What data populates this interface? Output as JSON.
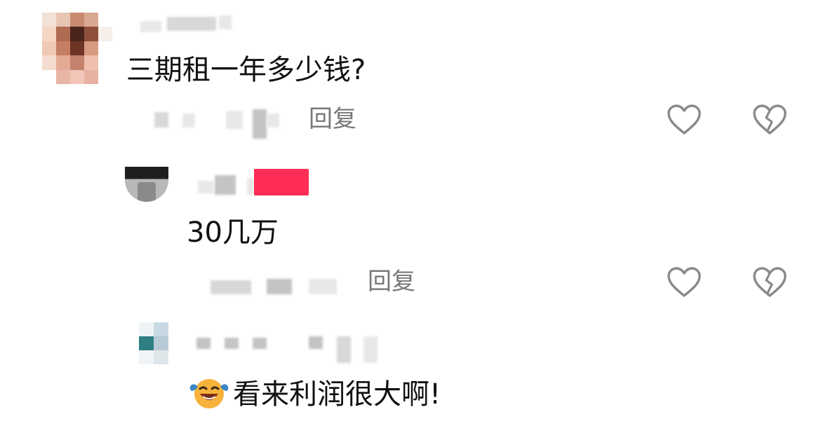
{
  "comments": [
    {
      "text": "三期租一年多少钱?",
      "reply_label": "回复"
    },
    {
      "text": "30几万",
      "reply_label": "回复"
    },
    {
      "text": "看来利润很大啊!"
    }
  ],
  "colors": {
    "text": "#111111",
    "reply": "#777777",
    "badge": "#ff2d55",
    "icon_stroke": "#8a8a8a"
  },
  "icons": {
    "like": "heart-outline-icon",
    "dislike": "broken-heart-outline-icon",
    "emoji": "laughing-tears-emoji-icon"
  }
}
